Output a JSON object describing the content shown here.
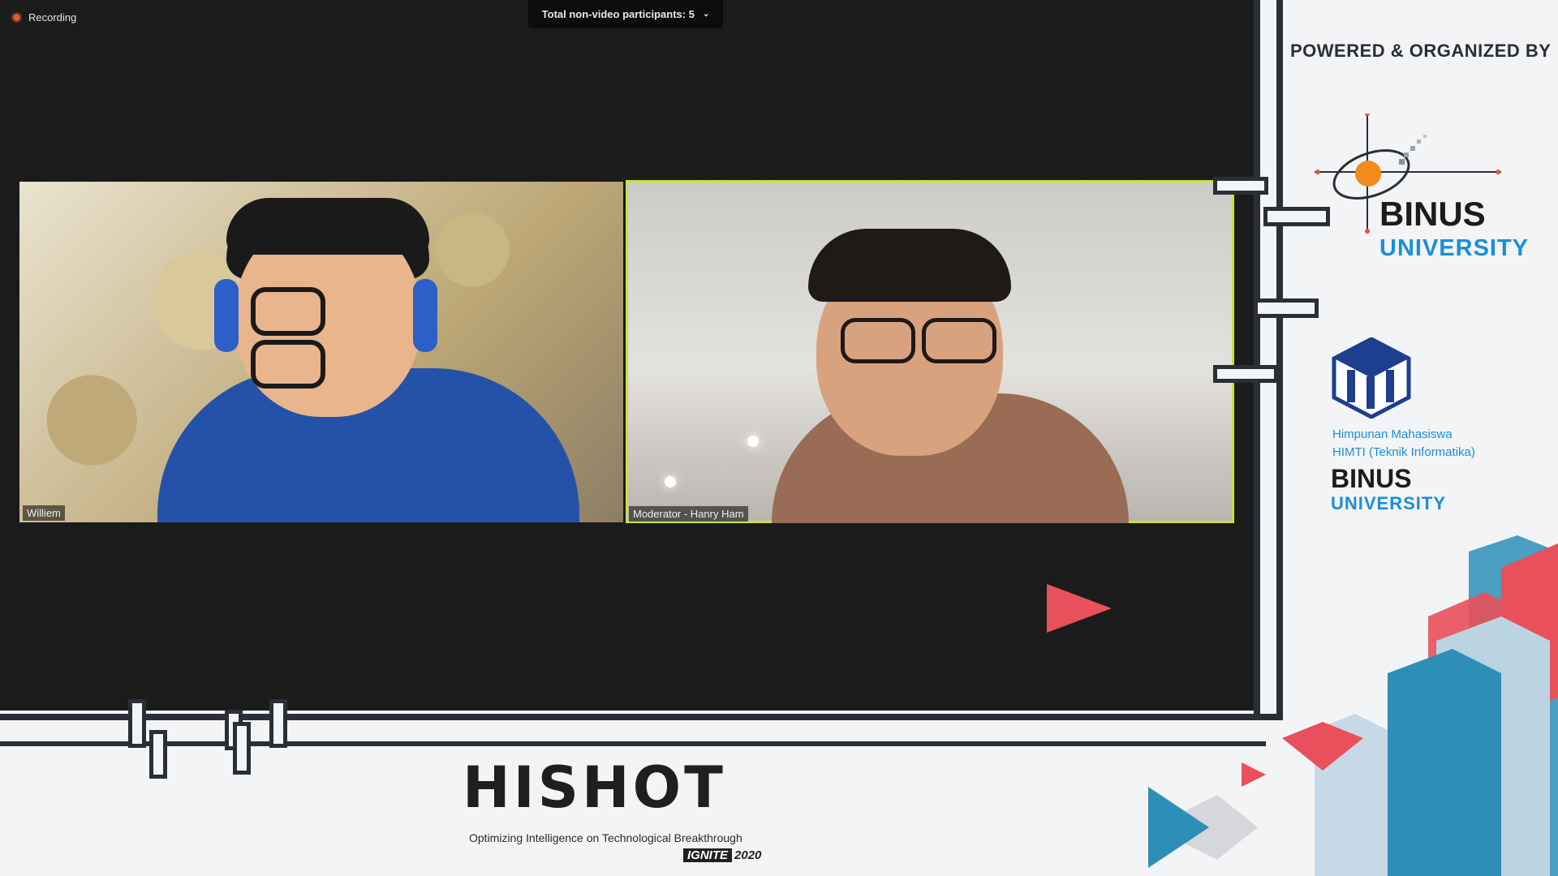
{
  "recording": {
    "label": "Recording"
  },
  "participants_bar": {
    "label": "Total non-video participants: 5"
  },
  "tiles": [
    {
      "name": "Williem"
    },
    {
      "name": "Moderator - Hanry Ham",
      "active": true
    }
  ],
  "sidebar": {
    "title": "POWERED & ORGANIZED BY",
    "binus_logo": {
      "line1": "BINUS",
      "line2": "UNIVERSITY"
    },
    "himti": {
      "line1": "Himpunan Mahasiswa",
      "line2": "HIMTI (Teknik Informatika)",
      "binus": "BINUS",
      "university": "UNIVERSITY"
    }
  },
  "event": {
    "title": "HISHOT",
    "tagline": "Optimizing Intelligence on Technological Breakthrough",
    "ignite": "IGNITE",
    "year": "2020"
  },
  "colors": {
    "active_speaker_border": "#c7e23a",
    "accent_blue": "#1b8fd6",
    "recording_dot": "#e2553c"
  }
}
